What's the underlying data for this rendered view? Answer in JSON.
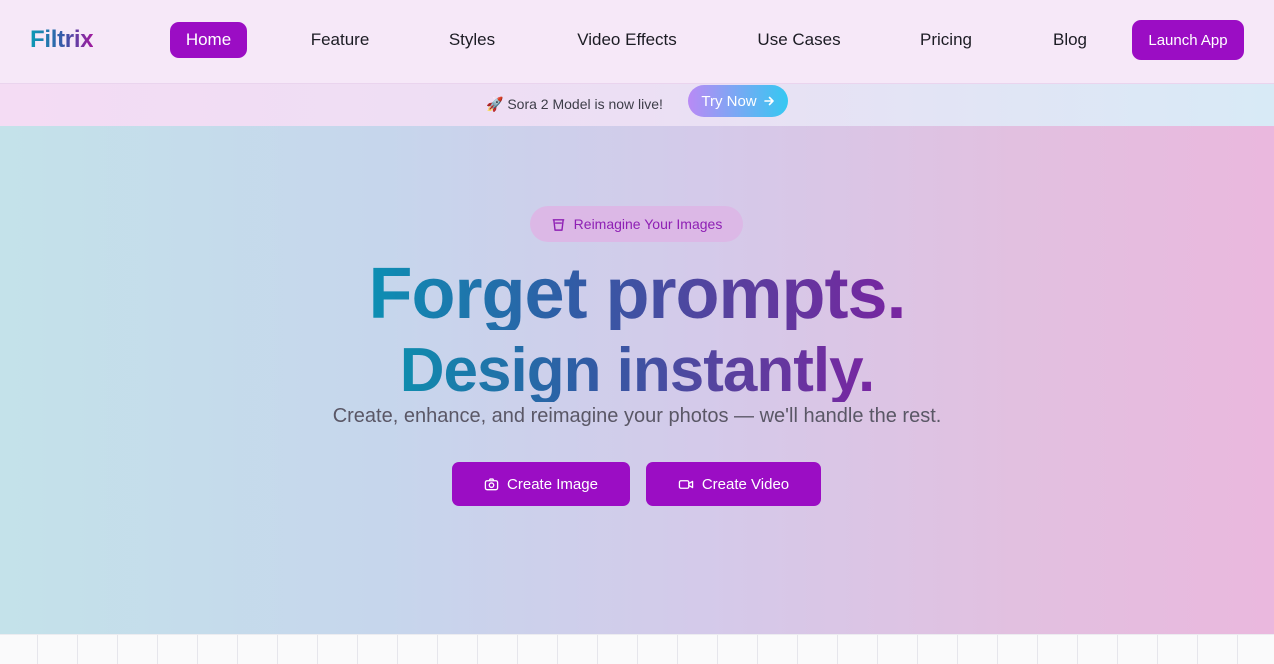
{
  "brand": {
    "name": "Filtrix"
  },
  "nav": {
    "items": [
      {
        "label": "Home",
        "active": true
      },
      {
        "label": "Feature",
        "active": false
      },
      {
        "label": "Styles",
        "active": false
      },
      {
        "label": "Video Effects",
        "active": false
      },
      {
        "label": "Use Cases",
        "active": false
      },
      {
        "label": "Pricing",
        "active": false
      },
      {
        "label": "Blog",
        "active": false
      }
    ],
    "launch_label": "Launch App"
  },
  "announcement": {
    "text": "🚀 Sora 2 Model is now live!",
    "cta_label": "Try Now",
    "cta_icon": "arrow-right-icon"
  },
  "hero": {
    "badge_label": "Reimagine Your Images",
    "badge_icon": "bucket-icon",
    "headline_line1": "Forget prompts.",
    "headline_line2": "Design instantly.",
    "subtitle": "Create, enhance, and reimagine your photos — we'll handle the rest.",
    "buttons": [
      {
        "label": "Create Image",
        "icon": "camera-icon"
      },
      {
        "label": "Create Video",
        "icon": "video-icon"
      }
    ]
  },
  "colors": {
    "accent": "#9b0dc4",
    "nav_bg": "#f6e8f8",
    "badge_bg": "#dcb8e6",
    "badge_text": "#8e20b4",
    "try_gradient_start": "#b98af5",
    "try_gradient_end": "#35c8f2"
  }
}
